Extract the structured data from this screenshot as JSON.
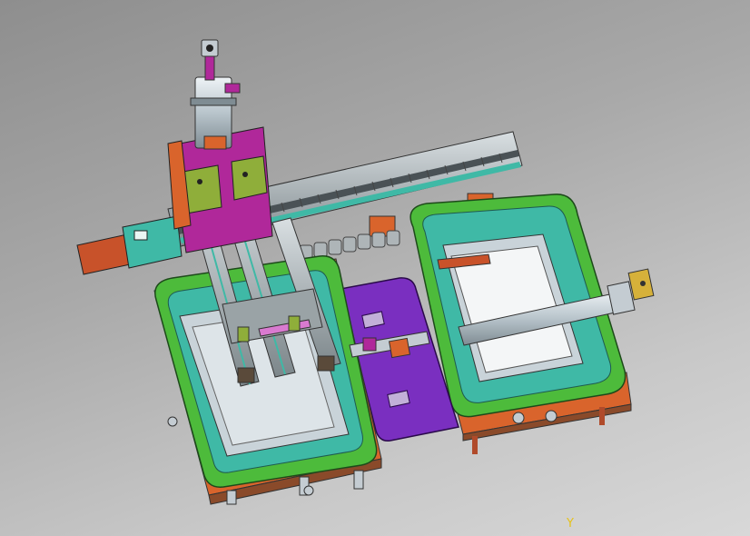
{
  "scene": {
    "type": "3d-cad-assembly",
    "background": [
      "#8e8e8e",
      "#d8d8d8"
    ],
    "colors": {
      "frame_green": "#4dbb3b",
      "frame_teal": "#3fb9a6",
      "plate_gray": "#c9d3d9",
      "rail_gray": "#9aa3a6",
      "magenta": "#b0289a",
      "purple": "#7a2fc0",
      "orange": "#d9642c",
      "brown": "#8a4a2a",
      "olive": "#8fae3a",
      "silver": "#c4ccd2",
      "axis_yellow": "#e6c21a"
    },
    "axis_label": "Y"
  }
}
